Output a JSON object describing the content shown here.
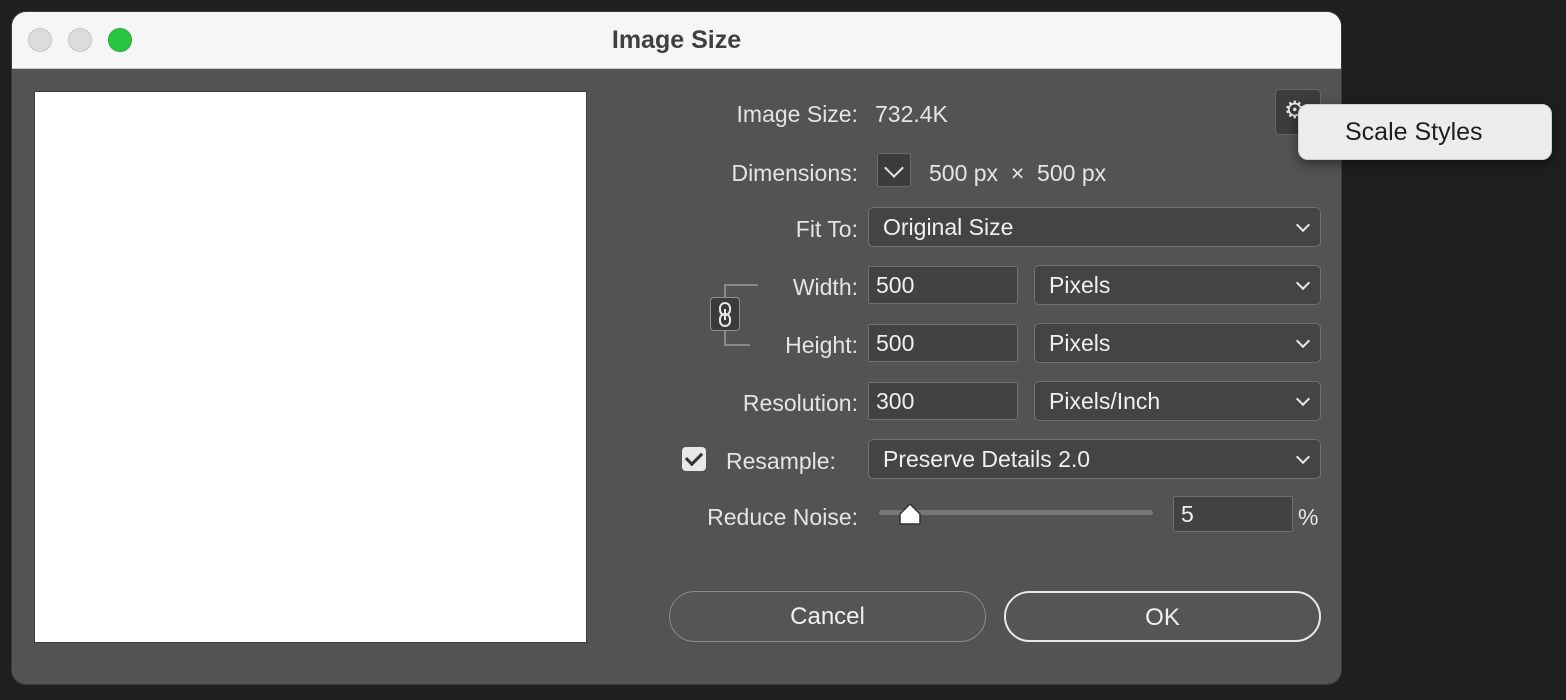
{
  "window": {
    "title": "Image Size",
    "traffic_colors": {
      "close": "#dcdcdc",
      "minimize": "#dcdcdc",
      "zoom": "#27c840"
    }
  },
  "info": {
    "image_size_label": "Image Size:",
    "image_size_value": "732.4K",
    "dimensions_label": "Dimensions:",
    "dimensions_value": "500 px  ×  500 px"
  },
  "fit_to": {
    "label": "Fit To:",
    "selected": "Original Size"
  },
  "width": {
    "label": "Width:",
    "value": "500",
    "unit": "Pixels"
  },
  "height": {
    "label": "Height:",
    "value": "500",
    "unit": "Pixels"
  },
  "resolution": {
    "label": "Resolution:",
    "value": "300",
    "unit": "Pixels/Inch"
  },
  "resample": {
    "label": "Resample:",
    "checked": true,
    "selected": "Preserve Details 2.0"
  },
  "reduce_noise": {
    "label": "Reduce Noise:",
    "value": "5",
    "unit": "%",
    "slider_fraction": 0.05
  },
  "buttons": {
    "cancel": "Cancel",
    "ok": "OK"
  },
  "settings_menu": {
    "icon": "gear-icon",
    "item": "Scale Styles"
  }
}
